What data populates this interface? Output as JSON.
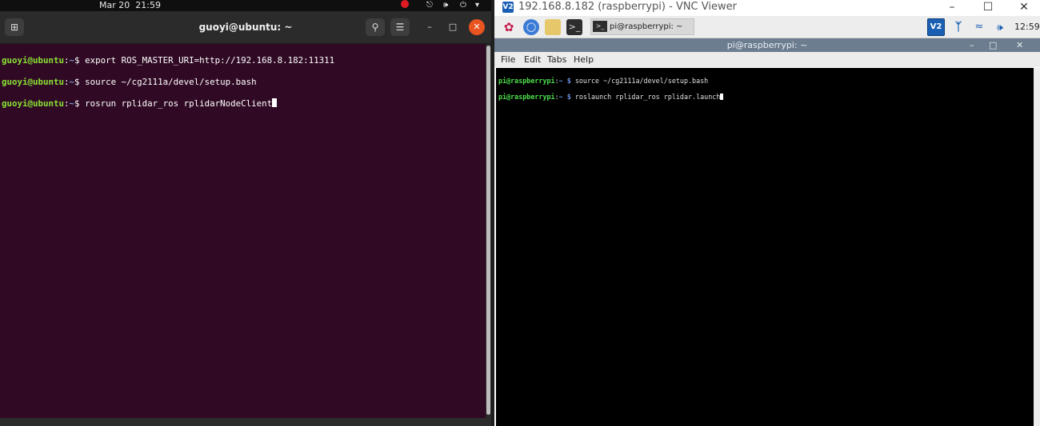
{
  "ubuntu": {
    "topbar": {
      "date": "Mar 20",
      "time": "21:59"
    },
    "window_title": "guoyi@ubuntu: ~",
    "terminal_lines": [
      {
        "user": "guoyi@ubuntu",
        "path": "~",
        "command": "export ROS_MASTER_URI=http://192.168.8.182:11311"
      },
      {
        "user": "guoyi@ubuntu",
        "path": "~",
        "command": "source ~/cg2111a/devel/setup.bash"
      },
      {
        "user": "guoyi@ubuntu",
        "path": "~",
        "command": "rosrun rplidar_ros rplidarNodeClient"
      }
    ]
  },
  "vnc": {
    "window_title": "192.168.8.182 (raspberrypi) - VNC Viewer",
    "pi_taskbar": {
      "task_label": "pi@raspberrypi: ~",
      "clock": "12:59"
    },
    "terminal_title": "pi@raspberrypi: ~",
    "menu": [
      "File",
      "Edit",
      "Tabs",
      "Help"
    ],
    "terminal_lines": [
      {
        "user": "pi@raspberrypi",
        "path": "~",
        "command": "source ~/cg2111a/devel/setup.bash"
      },
      {
        "user": "pi@raspberrypi",
        "path": "~",
        "command": "roslaunch rplidar_ros rplidar.launch"
      }
    ]
  },
  "colors": {
    "ubuntu_terminal_bg": "#300a24",
    "ubuntu_prompt": "#8ae234",
    "ubuntu_close": "#e95420",
    "pi_terminal_bg": "#000000",
    "pi_prompt": "#4ee04e"
  },
  "icons": [
    "new-tab-icon",
    "search-icon",
    "hamburger-menu-icon",
    "minimize-icon",
    "maximize-icon",
    "close-icon",
    "dnd-icon",
    "network-icon",
    "volume-icon",
    "power-icon",
    "raspberry-icon",
    "globe-icon",
    "folder-icon",
    "terminal-icon",
    "vnc-icon",
    "bluetooth-icon",
    "wifi-icon"
  ]
}
